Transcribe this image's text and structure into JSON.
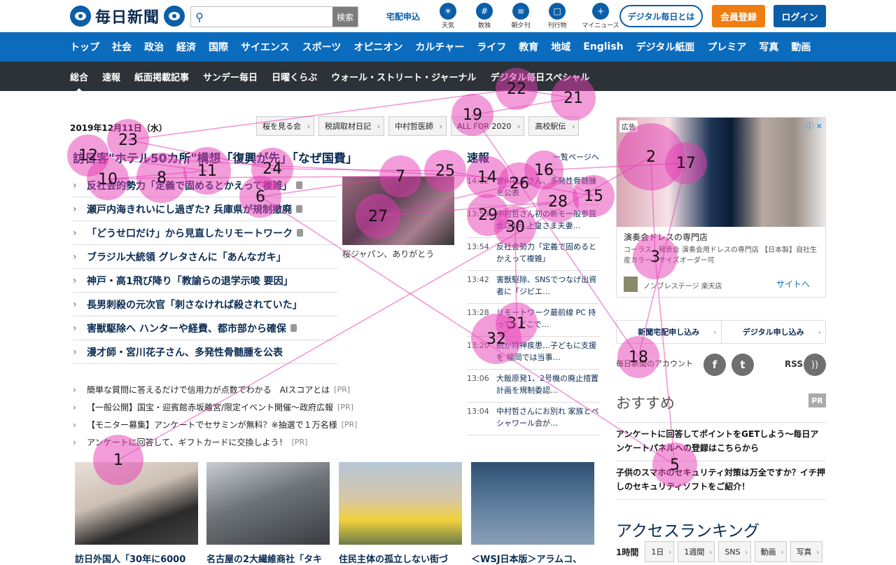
{
  "header": {
    "logo": "毎日新聞",
    "search_placeholder": "",
    "search_button": "検索",
    "delivery": "宅配申込",
    "icons": [
      {
        "name": "weather-icon",
        "label": "天気"
      },
      {
        "name": "sudoku-icon",
        "label": "数独"
      },
      {
        "name": "newspaper-icon",
        "label": "朝夕刊"
      },
      {
        "name": "book-icon",
        "label": "刊行物"
      },
      {
        "name": "mynews-icon",
        "label": "マイニュース"
      }
    ],
    "digital_button": "デジタル毎日とは",
    "register_button": "会員登録",
    "login_button": "ログイン"
  },
  "nav_primary": [
    "トップ",
    "社会",
    "政治",
    "経済",
    "国際",
    "サイエンス",
    "スポーツ",
    "オピニオン",
    "カルチャー",
    "ライフ",
    "教育",
    "地域",
    "English",
    "デジタル紙面",
    "プレミア",
    "写真",
    "動画"
  ],
  "nav_secondary": [
    "総合",
    "速報",
    "紙面掲載記事",
    "サンデー毎日",
    "日曜くらぶ",
    "ウォール・ストリート・ジャーナル",
    "デジタル毎日スペシャル"
  ],
  "date": "2019年12月11日（水）",
  "topics": [
    "桜を見る会",
    "税調取材日記",
    "中村哲医師",
    "ALL FOR 2020",
    "高校駅伝"
  ],
  "lead_headline": "訪日客\"ホテル50カ所\"構想「復興が先」「なぜ国費」",
  "news": [
    {
      "text": "反社会的勢力「定義で固めるとかえって複雑」",
      "lock": true
    },
    {
      "text": "瀬戸内海きれいにし過ぎた? 兵庫県が規制撤廃",
      "lock": true
    },
    {
      "text": "「どうせ口だけ」から見直したリモートワーク",
      "lock": true
    },
    {
      "text": "ブラジル大統領 グレタさんに「あんなガキ」",
      "lock": false
    },
    {
      "text": "神戸・高1飛び降り「教諭らの退学示唆 要因」",
      "lock": false
    },
    {
      "text": "長男刺殺の元次官「刺さなければ殺されていた」",
      "lock": false
    },
    {
      "text": "害獣駆除へ ハンターや経費、都市部から確保",
      "lock": true
    },
    {
      "text": "漫才師・宮川花子さん、多発性骨髄腫を公表",
      "lock": false
    }
  ],
  "photo_caption": "桜ジャパン、ありがとう",
  "breaking": {
    "title": "速報",
    "more": "一覧ページへ",
    "items": [
      {
        "time": "14:12",
        "text": "宮川花子さん、多発性骨髄腫を公表"
      },
      {
        "time": "13:55",
        "text": "中村哲さん初の新モー般参賀会に1月 上皇さま夫妻…"
      },
      {
        "time": "13:54",
        "text": "反社会勢力「定義で固めるとかえって複雑」"
      },
      {
        "time": "13:42",
        "text": "害獣駆除、SNSでつなげ出資者に「ジビエ…"
      },
      {
        "time": "13:28",
        "text": "リモートワーク最前線 PC 持って、どこで…"
      },
      {
        "time": "13:20",
        "text": "続か特神疾患…子どもに支援を 福岡では当事…"
      },
      {
        "time": "13:06",
        "text": "大飯原発1、2号機の廃止措置計画を規制委認…"
      },
      {
        "time": "13:04",
        "text": "中村哲さんにお別れ 家族とペシャワール会が…"
      }
    ]
  },
  "pr_items": [
    {
      "text": "簡単な質問に答えるだけで信用力が点数でわかる　AIスコアとは",
      "tag": "[PR]"
    },
    {
      "text": "【一般公開】国宝・迎賓館赤坂離宮/限定イベント開催〜政府広報",
      "tag": "[PR]"
    },
    {
      "text": "【モニター募集】アンケートでセサミンが無料？※抽選で１万名様",
      "tag": "[PR]"
    },
    {
      "text": "アンケートに回答して、ギフトカードに交換しよう！",
      "tag": "[PR]"
    }
  ],
  "cards": [
    {
      "caption": "訪日外国人「30年に6000"
    },
    {
      "caption": "名古屋の2大繊維商社「タキ"
    },
    {
      "caption": "住民主体の孤立しない街づ"
    },
    {
      "caption": "＜WSJ日本版＞アラムコ、"
    }
  ],
  "ad": {
    "tag": "広告",
    "title": "演奏会ドレスの専門店",
    "desc": "コーラス、発表会 演奏会用ドレスの専門店 【日本製】自社生産カラー・サイズオーダー可",
    "shop": "ノンブレステージ 楽天店",
    "link": "サイトへ"
  },
  "subscribe": [
    "新聞宅配申し込み",
    "デジタル申し込み"
  ],
  "account_label": "毎日新聞のアカウント",
  "rss": "RSS",
  "recommend": {
    "title": "おすすめ",
    "badge": "PR",
    "items": [
      "アンケートに回答してポイントをGETしよう〜毎日アンケートパネルへの登録はこちらから",
      "子供のスマホのセキュリティ対策は万全ですか？イチ押しのセキュリティソフトをご紹介！"
    ]
  },
  "ranking": {
    "title": "アクセスランキング",
    "label": "1時間",
    "tabs": [
      "1日",
      "1週間",
      "SNS",
      "動画",
      "写真"
    ]
  },
  "gaze_fixations": [
    "1",
    "2",
    "3",
    "5",
    "6",
    "7",
    "8",
    "10",
    "11",
    "12",
    "14",
    "15",
    "16",
    "17",
    "18",
    "19",
    "21",
    "22",
    "23",
    "24",
    "25",
    "26",
    "27",
    "28",
    "29",
    "30",
    "31",
    "32"
  ]
}
